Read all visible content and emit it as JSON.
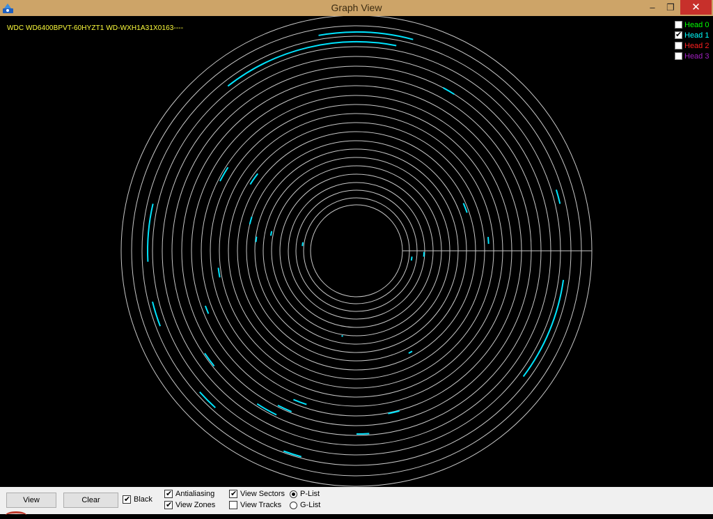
{
  "window": {
    "title": "Graph View",
    "minimize_glyph": "–",
    "maximize_glyph": "❐",
    "close_glyph": "✕",
    "app_icon": "disk-tool-icon"
  },
  "graph": {
    "drive_id": "WDC WD6400BPVT-60HYZT1 WD-WXH1A31X0163----",
    "background": "#000000",
    "track_color": "#c8c8c8",
    "defect_color": "#00e5ff"
  },
  "heads": [
    {
      "label": "Head 0",
      "checked": false,
      "color": "#00ff00"
    },
    {
      "label": "Head 1",
      "checked": true,
      "color": "#00ffff"
    },
    {
      "label": "Head 2",
      "checked": false,
      "color": "#ff2020"
    },
    {
      "label": "Head 3",
      "checked": false,
      "color": "#a020c0"
    }
  ],
  "controls": {
    "view_label": "View",
    "clear_label": "Clear",
    "black_label": "Black",
    "black_checked": true,
    "antialiasing_label": "Antialiasing",
    "antialiasing_checked": true,
    "view_zones_label": "View Zones",
    "view_zones_checked": true,
    "view_sectors_label": "View Sectors",
    "view_sectors_checked": true,
    "view_tracks_label": "View Tracks",
    "view_tracks_checked": false,
    "plist_label": "P-List",
    "plist_selected": true,
    "glist_label": "G-List",
    "glist_selected": false
  }
}
